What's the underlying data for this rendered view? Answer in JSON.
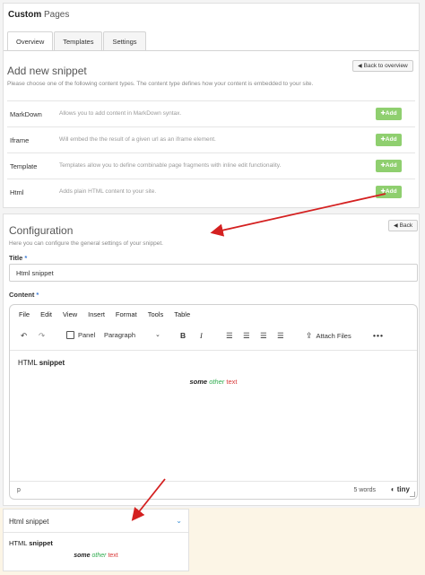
{
  "app": {
    "title_bold": "Custom",
    "title_rest": "Pages"
  },
  "tabs": [
    {
      "label": "Overview",
      "active": true
    },
    {
      "label": "Templates",
      "active": false
    },
    {
      "label": "Settings",
      "active": false
    }
  ],
  "snippet": {
    "title": "Add new snippet",
    "back_label": "Back to overview",
    "help": "Please choose one of the following content types. The content type defines how your content is embedded to your site.",
    "add_label": "Add",
    "types": [
      {
        "name": "MarkDown",
        "desc": "Allows you to add content in MarkDown syntax."
      },
      {
        "name": "Iframe",
        "desc": "Will embed the the result of a given url as an iframe element."
      },
      {
        "name": "Template",
        "desc": "Templates allow you to define combinable page fragments with inline edit functionality."
      },
      {
        "name": "Html",
        "desc": "Adds plain HTML content to your site."
      }
    ]
  },
  "config": {
    "title": "Configuration",
    "back_label": "Back",
    "help": "Here you can configure the general settings of your snippet.",
    "title_label": "Title",
    "required_mark": "*",
    "title_value": "Html snippet",
    "content_label": "Content"
  },
  "editor": {
    "menu": [
      "File",
      "Edit",
      "View",
      "Insert",
      "Format",
      "Tools",
      "Table"
    ],
    "toolbar": {
      "panel": "Panel",
      "format": "Paragraph",
      "attach": "Attach Files"
    },
    "content": {
      "heading_plain": "HTML",
      "heading_bold": "snippet",
      "w1": "some",
      "w2": "other",
      "w3": "text"
    },
    "status": {
      "path": "p",
      "words": "5 words",
      "brand": "tiny"
    }
  },
  "preview": {
    "title": "Html snippet"
  },
  "colors": {
    "add_button": "#8fcf6f",
    "required": "#3a7bd5",
    "arrow": "#d42020",
    "green_text": "#2eab4e",
    "red_text": "#d93a3a"
  }
}
